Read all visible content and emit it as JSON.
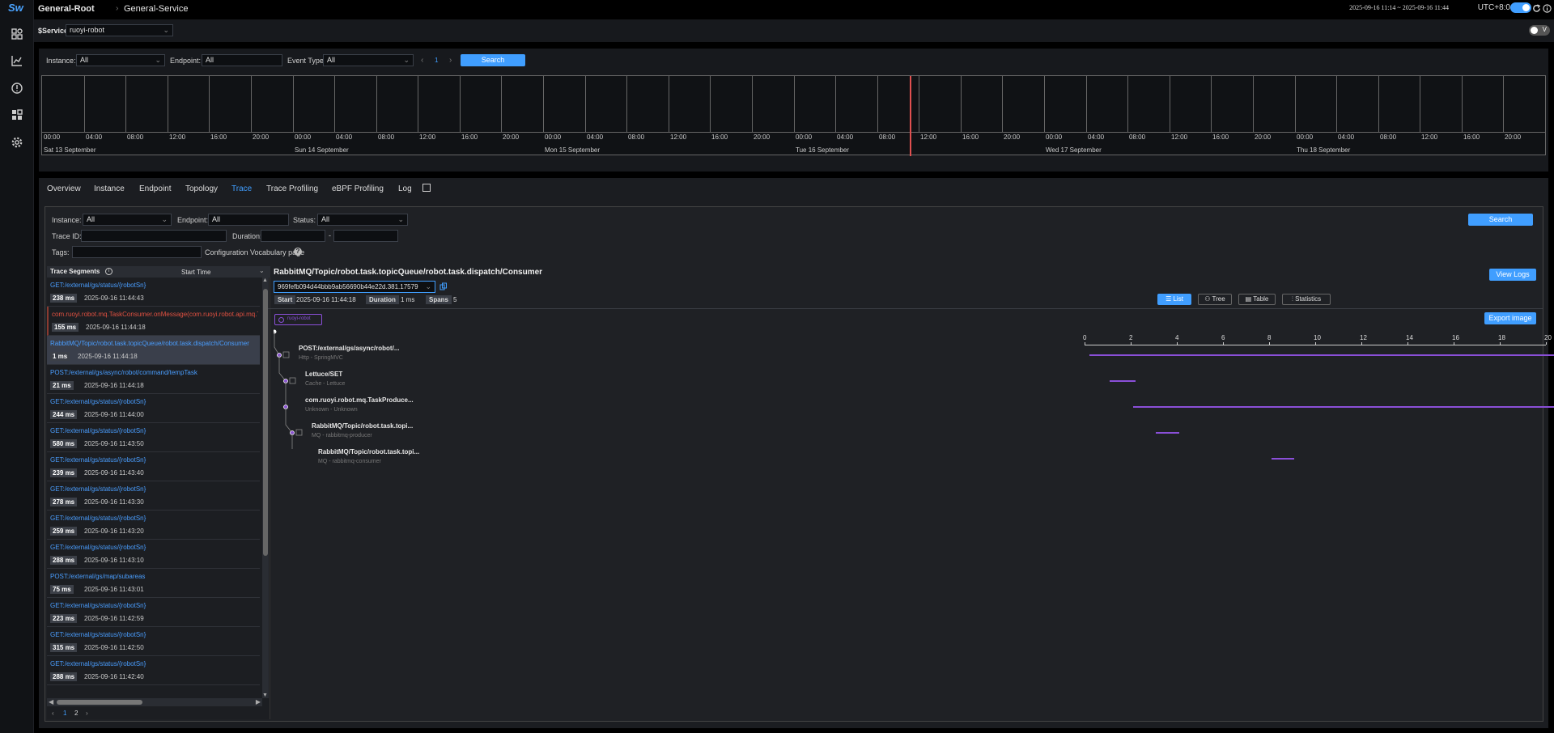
{
  "header": {
    "logo": "Sw",
    "crumb1": "General-Root",
    "crumb2": "General-Service",
    "time_range": "2025-09-16 11:14 ~ 2025-09-16 11:44",
    "timezone": "UTC+8:0"
  },
  "service_bar": {
    "label": "$Service",
    "value": "ruoyi-robot",
    "v_toggle": "V"
  },
  "events": {
    "instance_label": "Instance:",
    "instance_value": "All",
    "endpoint_label": "Endpoint:",
    "endpoint_value": "All",
    "event_type_label": "Event Type:",
    "event_type_value": "All",
    "page": "1",
    "search": "Search",
    "hours": [
      "00:00",
      "04:00",
      "08:00",
      "12:00",
      "16:00",
      "20:00"
    ],
    "days": [
      "Sat 13 September",
      "Sun 14 September",
      "Mon 15 September",
      "Tue 16 September",
      "Wed 17 September",
      "Thu 18 September"
    ]
  },
  "tabs": [
    "Overview",
    "Instance",
    "Endpoint",
    "Topology",
    "Trace",
    "Trace Profiling",
    "eBPF Profiling",
    "Log"
  ],
  "active_tab": "Trace",
  "trace_filters": {
    "instance_label": "Instance:",
    "instance_value": "All",
    "endpoint_label": "Endpoint:",
    "endpoint_value": "All",
    "status_label": "Status:",
    "status_value": "All",
    "trace_id_label": "Trace ID:",
    "duration_label": "Duration:",
    "duration_sep": "-",
    "tags_label": "Tags:",
    "vocab": "Configuration Vocabulary page",
    "search": "Search"
  },
  "segments": {
    "title": "Trace Segments",
    "sort": "Start Time",
    "items": [
      {
        "endpoint": "GET:/external/gs/status/{robotSn}",
        "duration": "238 ms",
        "time": "2025-09-16 11:44:43",
        "error": false
      },
      {
        "endpoint": "com.ruoyi.robot.mq.TaskConsumer.onMessage(com.ruoyi.robot.api.mq.T",
        "duration": "155 ms",
        "time": "2025-09-16 11:44:18",
        "error": true
      },
      {
        "endpoint": "RabbitMQ/Topic/robot.task.topicQueue/robot.task.dispatch/Consumer",
        "duration": "1 ms",
        "time": "2025-09-16 11:44:18",
        "error": false
      },
      {
        "endpoint": "POST:/external/gs/async/robot/command/tempTask",
        "duration": "21 ms",
        "time": "2025-09-16 11:44:18",
        "error": false
      },
      {
        "endpoint": "GET:/external/gs/status/{robotSn}",
        "duration": "244 ms",
        "time": "2025-09-16 11:44:00",
        "error": false
      },
      {
        "endpoint": "GET:/external/gs/status/{robotSn}",
        "duration": "580 ms",
        "time": "2025-09-16 11:43:50",
        "error": false
      },
      {
        "endpoint": "GET:/external/gs/status/{robotSn}",
        "duration": "239 ms",
        "time": "2025-09-16 11:43:40",
        "error": false
      },
      {
        "endpoint": "GET:/external/gs/status/{robotSn}",
        "duration": "278 ms",
        "time": "2025-09-16 11:43:30",
        "error": false
      },
      {
        "endpoint": "GET:/external/gs/status/{robotSn}",
        "duration": "259 ms",
        "time": "2025-09-16 11:43:20",
        "error": false
      },
      {
        "endpoint": "GET:/external/gs/status/{robotSn}",
        "duration": "288 ms",
        "time": "2025-09-16 11:43:10",
        "error": false
      },
      {
        "endpoint": "POST:/external/gs/map/subareas",
        "duration": "75 ms",
        "time": "2025-09-16 11:43:01",
        "error": false
      },
      {
        "endpoint": "GET:/external/gs/status/{robotSn}",
        "duration": "223 ms",
        "time": "2025-09-16 11:42:59",
        "error": false
      },
      {
        "endpoint": "GET:/external/gs/status/{robotSn}",
        "duration": "315 ms",
        "time": "2025-09-16 11:42:50",
        "error": false
      },
      {
        "endpoint": "GET:/external/gs/status/{robotSn}",
        "duration": "288 ms",
        "time": "2025-09-16 11:42:40",
        "error": false
      }
    ],
    "pages": [
      "1",
      "2"
    ]
  },
  "detail": {
    "title": "RabbitMQ/Topic/robot.task.topicQueue/robot.task.dispatch/Consumer",
    "view_logs": "View Logs",
    "trace_id": "969fefb094d44bbb9ab56690b44e22d.381.17579",
    "start_label": "Start",
    "start_value": "2025-09-16 11:44:18",
    "duration_label": "Duration",
    "duration_value": "1 ms",
    "spans_label": "Spans",
    "spans_value": "5",
    "views": [
      "List",
      "Tree",
      "Table",
      "Statistics"
    ],
    "active_view": "List",
    "export": "Export image",
    "service_tag": "ruoyi-robot",
    "axis": [
      "0",
      "2",
      "4",
      "6",
      "8",
      "10",
      "12",
      "14",
      "16",
      "18",
      "20"
    ],
    "spans": [
      {
        "name": "POST:/external/gs/async/robot/...",
        "sub": "Http - SpringMVC",
        "start": 0.2,
        "end": 21.3
      },
      {
        "name": "Lettuce/SET",
        "sub": "Cache - Lettuce",
        "start": 1.1,
        "end": 2.2
      },
      {
        "name": "com.ruoyi.robot.mq.TaskProduce...",
        "sub": "Unknown - Unknown",
        "start": 2.1,
        "end": 21.3
      },
      {
        "name": "RabbitMQ/Topic/robot.task.topi...",
        "sub": "MQ - rabbitmq-producer",
        "start": 3.1,
        "end": 4.1
      },
      {
        "name": "RabbitMQ/Topic/robot.task.topi...",
        "sub": "MQ - rabbitmq-consumer",
        "start": 8.1,
        "end": 9.1
      }
    ]
  },
  "colors": {
    "accent": "#409eff",
    "error": "#e05040",
    "span": "#8a4fd8",
    "now_line": "#e05050"
  }
}
